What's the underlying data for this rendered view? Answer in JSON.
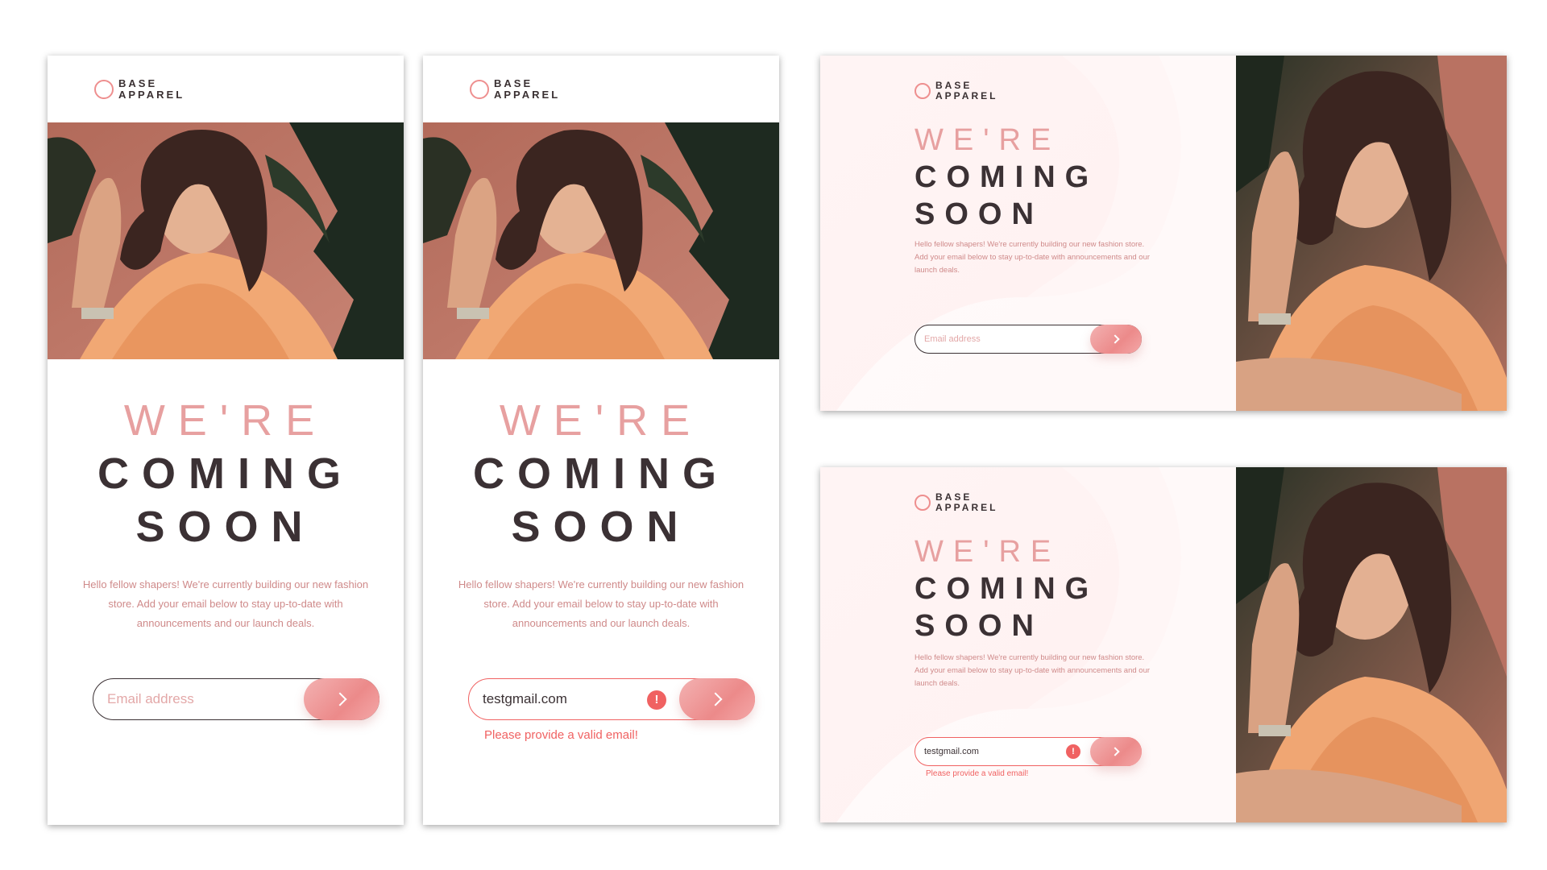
{
  "brand": {
    "line1": "BASE",
    "line2": "APPAREL"
  },
  "headline": {
    "line1": "WE'RE",
    "line2": "COMING",
    "line3": "SOON"
  },
  "description": "Hello fellow shapers! We're currently building our new fashion store. Add your email below to stay up-to-date with announcements and our launch deals.",
  "form": {
    "placeholder": "Email address",
    "invalid_value": "testgmail.com",
    "error_icon": "!",
    "error_message": "Please provide a valid email!",
    "submit_icon": "chevron-right-icon"
  },
  "colors": {
    "accent": "#ee8f8f",
    "error": "#f06262",
    "text_dark": "#3b3134",
    "panel_bg": "#fff4f4"
  }
}
